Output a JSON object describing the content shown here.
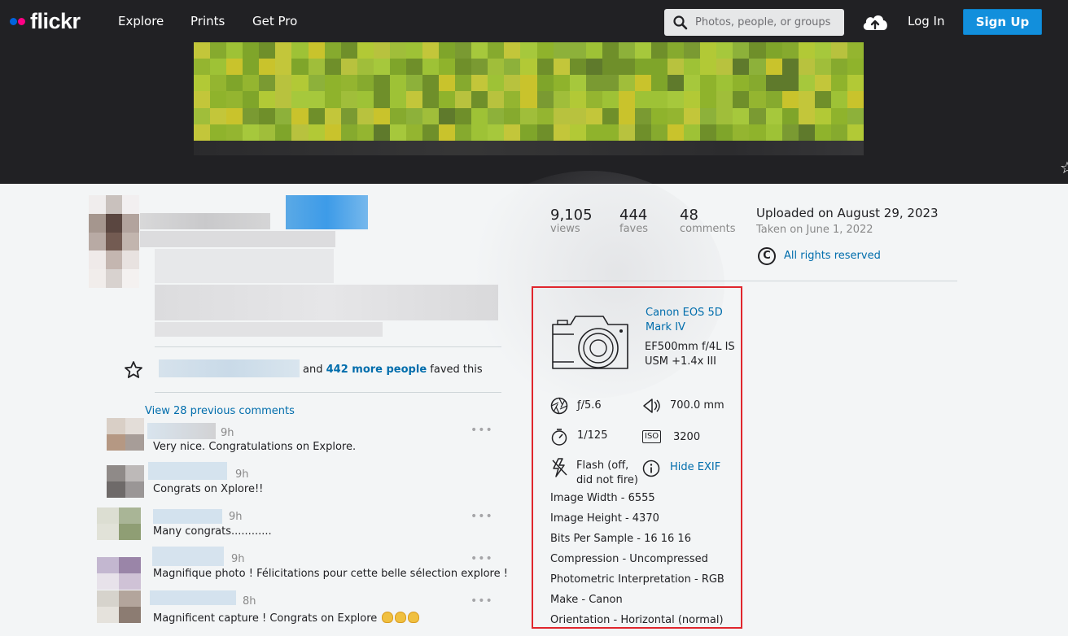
{
  "header": {
    "logo_text": "flickr",
    "nav": [
      "Explore",
      "Prints",
      "Get Pro"
    ],
    "search_placeholder": "Photos, people, or groups",
    "login_label": "Log In",
    "signup_label": "Sign Up"
  },
  "stats": {
    "views_count": "9,105",
    "views_label": "views",
    "faves_count": "444",
    "faves_label": "faves",
    "comments_count": "48",
    "comments_label": "comments"
  },
  "meta": {
    "uploaded": "Uploaded on August 29, 2023",
    "taken": "Taken on June 1, 2022",
    "rights_symbol": "C",
    "rights": "All rights reserved"
  },
  "exif": {
    "camera_line1": "Canon EOS 5D",
    "camera_line2": "Mark IV",
    "lens_line1": "EF500mm f/4L IS",
    "lens_line2": "USM +1.4x III",
    "aperture": "ƒ/5.6",
    "focal_length": "700.0 mm",
    "shutter": "1/125",
    "iso_badge": "ISO",
    "iso": "3200",
    "flash_line1": "Flash (off,",
    "flash_line2": "did not fire)",
    "hide_exif": "Hide EXIF",
    "rows": [
      "Image Width - 6555",
      "Image Height - 4370",
      "Bits Per Sample - 16 16 16",
      "Compression - Uncompressed",
      "Photometric Interpretation - RGB",
      "Make - Canon",
      "Orientation - Horizontal (normal)"
    ]
  },
  "faves": {
    "and_text": "and",
    "more_people": "442 more people",
    "faved_this": "faved this"
  },
  "comments": {
    "view_previous": "View 28 previous comments",
    "items": [
      {
        "time": "9h",
        "text": "Very nice. Congratulations on Explore.",
        "more": "•••"
      },
      {
        "time": "9h",
        "text": "Congrats on Xplore!!",
        "more": "•••"
      },
      {
        "time": "9h",
        "text": "Many congrats............",
        "more": "•••"
      },
      {
        "time": "9h",
        "text": "Magnifique photo ! Félicitations pour cette belle sélection explore !",
        "more": "•••"
      },
      {
        "time": "8h",
        "text": "Magnificent capture ! Congrats on Explore",
        "more": "•••"
      }
    ]
  },
  "colors": {
    "header_bg": "#212124",
    "link_blue": "#006dac",
    "signup_blue": "#128fdc",
    "highlight_red": "#e0262d"
  }
}
